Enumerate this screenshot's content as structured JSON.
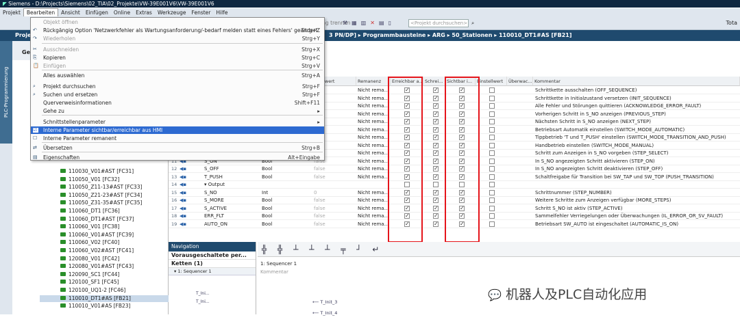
{
  "title_bar": "Siemens - D:\\Projects\\Siemens\\02_TIA\\02_Projekte\\VW-39E001V6\\VW-39E001V6",
  "menubar": [
    "Projekt",
    "Bearbeiten",
    "Ansicht",
    "Einfügen",
    "Online",
    "Extras",
    "Werkzeuge",
    "Fenster",
    "Hilfe"
  ],
  "toolbar": {
    "search_placeholder": "<Projekt durchsuchen>",
    "connection_text": "ndung trennen",
    "right_label": "Tota"
  },
  "breadcrumb": "3 PN/DP] ▸ Programmbausteine ▸ ARG ▸ 50_Stationen ▸ 110010_DT1#AS [FB21]",
  "breadcrumb_left": "Proje",
  "left_tab": "PLC-Programmierung",
  "tree_header": "Ge",
  "edit_menu": [
    {
      "label": "Objekt öffnen",
      "shortcut": "",
      "disabled": true
    },
    {
      "label": "Rückgängig Option 'Netzwerkfehler als Wartungsanforderung/-bedarf melden statt eines Fehlers' geändert.",
      "shortcut": "Strg+Z",
      "disabled": false
    },
    {
      "label": "Wiederholen",
      "shortcut": "Strg+Y",
      "disabled": true
    },
    {
      "label": "Ausschneiden",
      "shortcut": "Strg+X",
      "disabled": true
    },
    {
      "label": "Kopieren",
      "shortcut": "Strg+C",
      "disabled": false
    },
    {
      "label": "Einfügen",
      "shortcut": "Strg+V",
      "disabled": true
    },
    {
      "label": "Alles auswählen",
      "shortcut": "Strg+A",
      "disabled": false
    },
    {
      "label": "Projekt durchsuchen",
      "shortcut": "Strg+F",
      "disabled": false
    },
    {
      "label": "Suchen und ersetzen",
      "shortcut": "Strg+F",
      "disabled": false
    },
    {
      "label": "Querverweisinformationen",
      "shortcut": "Shift+F11",
      "disabled": false
    },
    {
      "label": "Gehe zu",
      "shortcut": "▸",
      "disabled": false
    },
    {
      "label": "Schnittstellenparameter",
      "shortcut": "▸",
      "disabled": false
    },
    {
      "label": "Interne Parameter sichtbar/erreichbar aus HMI",
      "shortcut": "",
      "disabled": false
    },
    {
      "label": "Interne Parameter remanent",
      "shortcut": "",
      "disabled": false
    },
    {
      "label": "Übersetzen",
      "shortcut": "Strg+B",
      "disabled": false
    },
    {
      "label": "Eigenschaften",
      "shortcut": "Alt+Eingabe",
      "disabled": false
    }
  ],
  "grid_headers": [
    "Startwert",
    "Remanenz",
    "Erreichbar a...",
    "Schrei...",
    "Sichtbar i...",
    "Einstellwert",
    "Überwac...",
    "Kommentar"
  ],
  "grid_rows": [
    {
      "no": "",
      "name": "",
      "type": "",
      "start": "",
      "rem": "Nicht rema...",
      "c": "Schrittkette ausschalten (OFF_SEQUENCE)"
    },
    {
      "no": "",
      "name": "",
      "type": "",
      "start": "",
      "rem": "Nicht rema...",
      "c": "Schrittkette in Initialzustand versetzen (INIT_SEQUENCE)"
    },
    {
      "no": "",
      "name": "",
      "type": "",
      "start": "",
      "rem": "Nicht rema...",
      "c": "Alle Fehler und Störungen quittieren (ACKNOWLEDGE_ERROR_FAULT)"
    },
    {
      "no": "",
      "name": "",
      "type": "",
      "start": "",
      "rem": "Nicht rema...",
      "c": "Vorherigen Schritt in S_NO anzeigen (PREVIOUS_STEP)"
    },
    {
      "no": "",
      "name": "",
      "type": "",
      "start": "",
      "rem": "Nicht rema...",
      "c": "Nächsten Schritt in S_NO anzeigen (NEXT_STEP)"
    },
    {
      "no": "",
      "name": "",
      "type": "",
      "start": "",
      "rem": "Nicht rema...",
      "c": "Betriebsart Automatik einstellen (SWITCH_MODE_AUTOMATIC)"
    },
    {
      "no": "",
      "name": "",
      "type": "",
      "start": "",
      "rem": "Nicht rema...",
      "c": "Tippbetrieb 'T und T_PUSH' einstellen (SWITCH_MODE_TRANSITION_AND_PUSH)"
    },
    {
      "no": "",
      "name": "",
      "type": "",
      "start": "",
      "rem": "Nicht rema...",
      "c": "Handbetrieb einstellen (SWITCH_MODE_MANUAL)"
    },
    {
      "no": "",
      "name": "",
      "type": "",
      "start": "",
      "rem": "Nicht rema...",
      "c": "Schritt zum Anzeigen in S_NO vorgeben (STEP_SELECT)"
    },
    {
      "no": "11",
      "name": "S_ON",
      "type": "Bool",
      "start": "false",
      "rem": "Nicht rema...",
      "c": "In S_NO angezeigten Schritt aktivieren (STEP_ON)"
    },
    {
      "no": "12",
      "name": "S_OFF",
      "type": "Bool",
      "start": "false",
      "rem": "Nicht rema...",
      "c": "In S_NO angezeigten Schritt deaktivieren (STEP_OFF)"
    },
    {
      "no": "13",
      "name": "T_PUSH",
      "type": "Bool",
      "start": "false",
      "rem": "Nicht rema...",
      "c": "Schaltfreigabe für Transition bei SW_TAP und SW_TOP (PUSH_TRANSITION)"
    },
    {
      "no": "14",
      "name": "▾ Output",
      "type": "",
      "start": "",
      "rem": "",
      "c": ""
    },
    {
      "no": "15",
      "name": "S_NO",
      "type": "Int",
      "start": "0",
      "rem": "Nicht rema...",
      "c": "Schrittnummer (STEP_NUMBER)"
    },
    {
      "no": "16",
      "name": "S_MORE",
      "type": "Bool",
      "start": "false",
      "rem": "Nicht rema...",
      "c": "Weitere Schritte zum Anzeigen verfügbar (MORE_STEPS)"
    },
    {
      "no": "17",
      "name": "S_ACTIVE",
      "type": "Bool",
      "start": "false",
      "rem": "Nicht rema...",
      "c": "Schritt S_NO ist aktiv (STEP_ACTIVE)"
    },
    {
      "no": "18",
      "name": "ERR_FLT",
      "type": "Bool",
      "start": "false",
      "rem": "Nicht rema...",
      "c": "Sammelfehler Verriegelungen oder Überwachungen (IL_ERROR_OR_SV_FAULT)"
    },
    {
      "no": "19",
      "name": "AUTO_ON",
      "type": "Bool",
      "start": "false",
      "rem": "Nicht rema...",
      "c": "Betriebsart SW_AUTO ist eingeschaltet (AUTOMATIC_IS_ON)"
    }
  ],
  "tree_items": [
    "110030_V01#AST [FC31]",
    "110050_V01 [FC32]",
    "110050_Z11-13#AST [FC33]",
    "110050_Z21-23#AST [FC34]",
    "110050_Z31-35#AST [FC35]",
    "110060_DT1 [FC36]",
    "110060_DT1#AST [FC37]",
    "110060_V01 [FC38]",
    "110060_V01#AST [FC39]",
    "110060_V02 [FC40]",
    "110060_V02#AST [FC41]",
    "120080_V01 [FC42]",
    "120080_V01#AST [FC43]",
    "120090_SC1 [FC44]",
    "120100_SF1 [FC45]",
    "120100_UQ1-2 [FC46]",
    "110010_DT1#AS [FB21]",
    "110010_V01#AS [FB23]"
  ],
  "navigation": {
    "title": "Navigation",
    "row1": "Vorausgeschaltete per...",
    "row2": "Ketten (1)",
    "row3": "▾ 1: Sequencer 1",
    "items": [
      "T_Ini...",
      "T_Ini..."
    ]
  },
  "sfc": {
    "tools": "╬ ╬ ┴ ┴ ┴ ╤ ┘ ↵",
    "seq_label": "1: Sequencer 1",
    "comment": "Kommentar",
    "t1": "T_Init_3",
    "t2": "T_Init_4"
  },
  "watermark": "机器人及PLC自动化应用"
}
